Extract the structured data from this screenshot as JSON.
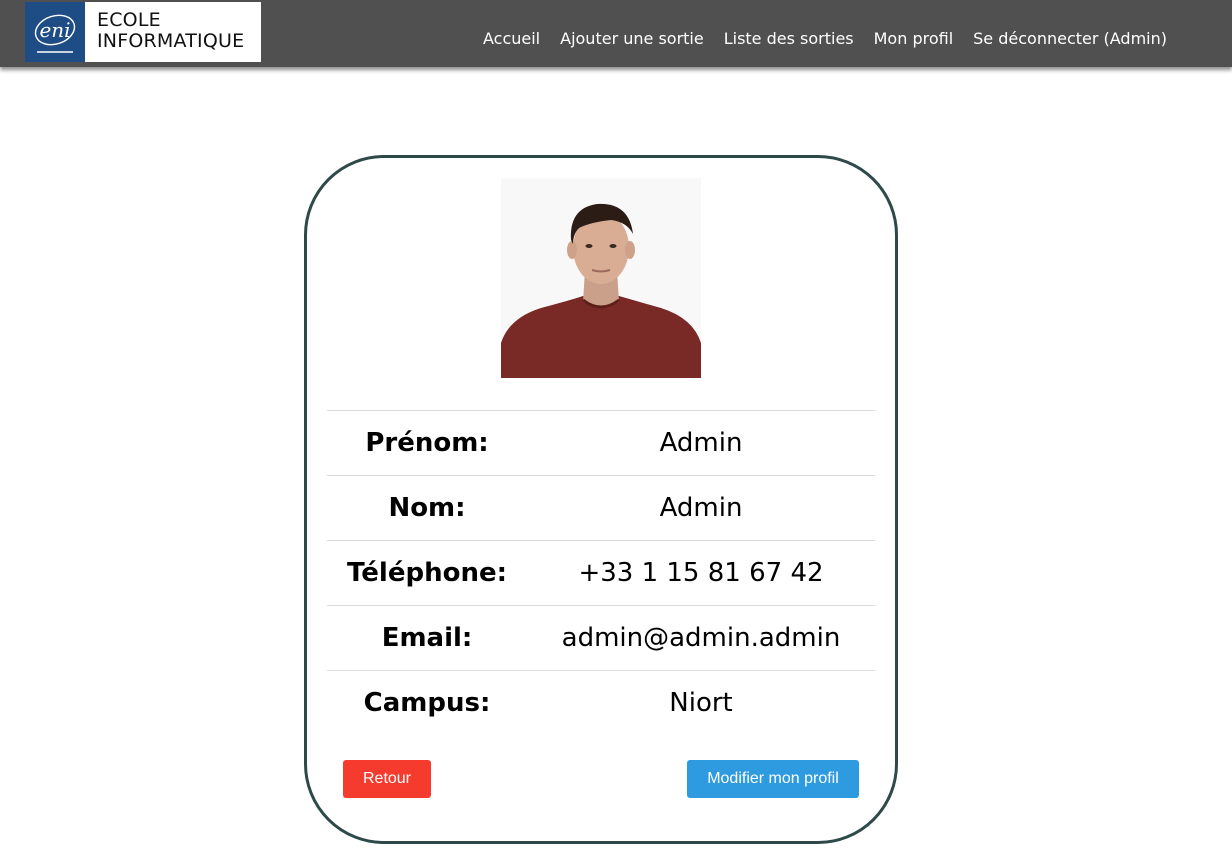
{
  "brand": {
    "mark_text": "eni",
    "line1": "ECOLE",
    "line2": "INFORMATIQUE",
    "mark_color": "#1e4d85"
  },
  "nav": {
    "items": [
      {
        "label": "Accueil"
      },
      {
        "label": "Ajouter une sortie"
      },
      {
        "label": "Liste des sorties"
      },
      {
        "label": "Mon profil"
      },
      {
        "label": "Se déconnecter (Admin)"
      }
    ]
  },
  "profile": {
    "rows": [
      {
        "label": "Prénom:",
        "value": "Admin"
      },
      {
        "label": "Nom:",
        "value": "Admin"
      },
      {
        "label": "Téléphone:",
        "value": "+33 1 15 81 67 42"
      },
      {
        "label": "Email:",
        "value": "admin@admin.admin"
      },
      {
        "label": "Campus:",
        "value": "Niort"
      }
    ]
  },
  "actions": {
    "back_label": "Retour",
    "edit_label": "Modifier mon profil"
  },
  "colors": {
    "navbar": "#505050",
    "card_border": "#2d4a49",
    "back_button": "#f53a2e",
    "edit_button": "#2e9ae0"
  }
}
